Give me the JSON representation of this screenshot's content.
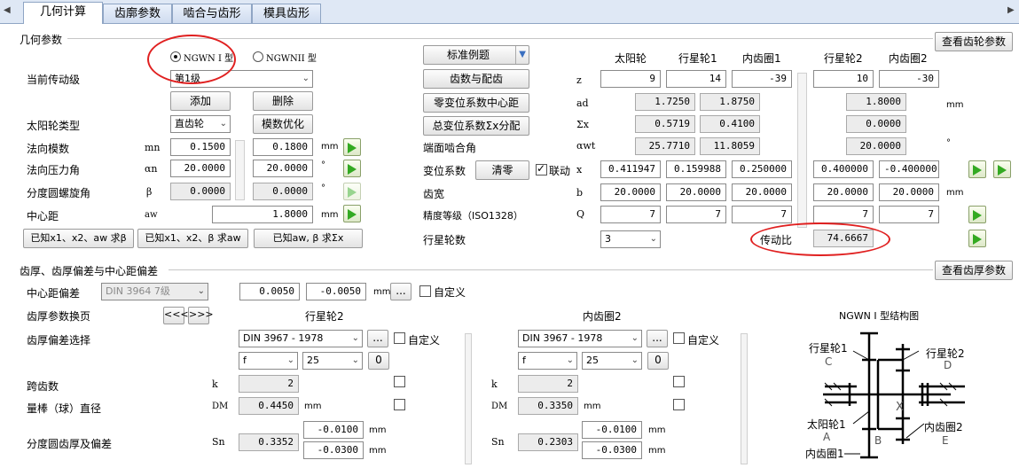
{
  "tabs": [
    "几何计算",
    "齿廓参数",
    "啮合与齿形",
    "模具齿形"
  ],
  "section1": {
    "title": "几何参数",
    "view_gear_button": "查看齿轮参数",
    "type_radio1": "NGWN I 型",
    "type_radio2": "NGWNII 型",
    "stage_label": "当前传动级",
    "stage_value": "第1级",
    "add_button": "添加",
    "delete_button": "删除",
    "sun_type_label": "太阳轮类型",
    "sun_type_value": "直齿轮",
    "modulus_opt_button": "模数优化",
    "normal_module_label": "法向模数",
    "normal_module_sym": "mn",
    "normal_module_v1": "0.1500",
    "normal_module_v2": "0.1800",
    "normal_module_unit": "mm",
    "pressure_angle_label": "法向压力角",
    "pressure_angle_sym": "αn",
    "pressure_angle_v1": "20.0000",
    "pressure_angle_v2": "20.0000",
    "degree": "°",
    "helix_label": "分度圆螺旋角",
    "helix_sym": "β",
    "helix_v1": "0.0000",
    "helix_v2": "0.0000",
    "center_label": "中心距",
    "center_sym": "aw",
    "center_value": "1.8000",
    "center_unit": "mm",
    "calc_btn1": "已知x1、x2、aw 求β",
    "calc_btn2": "已知x1、x2、β 求aw",
    "calc_btn3": "已知aw, β 求Σx",
    "std_example_button": "标准例题",
    "teeth_match_button": "齿数与配齿",
    "zero_shift_button": "零变位系数中心距",
    "total_shift_button": "总变位系数Σx分配",
    "transverse_angle_label": "端面啮合角",
    "shift_label": "变位系数",
    "clear_button": "清零",
    "link_label": "联动",
    "face_width_label": "齿宽",
    "accuracy_label": "精度等级（ISO1328）",
    "planet_count_label": "行星轮数",
    "planet_count_value": "3",
    "ratio_label": "传动比",
    "ratio_value": "74.6667",
    "cols": [
      "太阳轮",
      "行星轮1",
      "内齿圈1",
      "行星轮2",
      "内齿圈2"
    ],
    "row_syms": [
      "z",
      "ad",
      "Σx",
      "αwt",
      "x",
      "b",
      "Q"
    ],
    "z": [
      "9",
      "14",
      "-39",
      "10",
      "-30"
    ],
    "ad": [
      "1.7250",
      "1.8750",
      "1.8000"
    ],
    "ad_unit": "mm",
    "sumx": [
      "0.5719",
      "0.4100",
      "0.0000"
    ],
    "awt": [
      "25.7710",
      "11.8059",
      "20.0000"
    ],
    "awt_unit": "°",
    "x": [
      "0.411947",
      "0.159988",
      "0.250000",
      "0.400000",
      "-0.400000"
    ],
    "b": [
      "20.0000",
      "20.0000",
      "20.0000",
      "20.0000",
      "20.0000"
    ],
    "b_unit": "mm",
    "q": [
      "7",
      "7",
      "7",
      "7",
      "7"
    ]
  },
  "section2": {
    "title": "齿厚、齿厚偏差与中心距偏差",
    "view_thickness_button": "查看齿厚参数",
    "center_dev_label": "中心距偏差",
    "center_dev_std": "DIN 3964 7级",
    "center_dev_v1": "0.0050",
    "center_dev_v2": "-0.0050",
    "unit_mm": "mm",
    "ellipsis": "...",
    "custom_label": "自定义",
    "switch_label": "齿厚参数换页",
    "prev_button": "<<<",
    "next_button": ">>>",
    "col1_title": "行星轮2",
    "col2_title": "内齿圈2",
    "tol_select_label": "齿厚偏差选择",
    "std_din": "DIN 3967  - 1978",
    "tol_f": "f",
    "tol_25": "25",
    "tol_0": "0",
    "span_label": "跨齿数",
    "span_sym": "k",
    "span1": "2",
    "span2": "2",
    "ball_label": "量棒（球）直径",
    "ball_sym": "DM",
    "ball1": "0.4450",
    "ball2": "0.3350",
    "thick_label": "分度圆齿厚及偏差",
    "thick_sym": "Sn",
    "thick1": "0.3352",
    "thick1_up": "-0.0100",
    "thick1_lo": "-0.0300",
    "thick2": "0.2303",
    "thick2_up": "-0.0100",
    "thick2_lo": "-0.0300"
  },
  "diagram": {
    "title": "NGWN I 型结构图",
    "l_planet1": "行星轮1",
    "l_c": "C",
    "l_planet2": "行星轮2",
    "l_d": "D",
    "l_x": "X",
    "l_sun": "太阳轮1",
    "l_a": "A",
    "l_b": "B",
    "l_ring2": "内齿圈2",
    "l_e": "E",
    "l_ring1": "内齿圈1"
  }
}
